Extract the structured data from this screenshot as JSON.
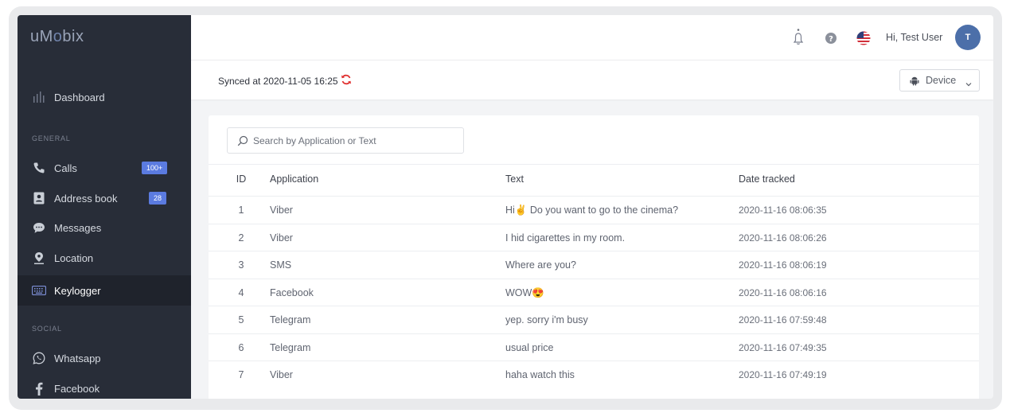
{
  "app": {
    "logo_prefix": "uM",
    "logo_rest": "obix",
    "logo_o": "o"
  },
  "sidebar": {
    "dashboard": {
      "label": "Dashboard",
      "icon": "bar-chart-icon"
    },
    "sections": [
      {
        "label": "GENERAL"
      },
      {
        "label": "SOCIAL"
      }
    ],
    "items": [
      {
        "label": "Calls",
        "icon": "phone-icon",
        "badge": "100+"
      },
      {
        "label": "Address book",
        "icon": "contact-card-icon",
        "badge": "28"
      },
      {
        "label": "Messages",
        "icon": "chat-bubble-icon"
      },
      {
        "label": "Location",
        "icon": "map-pin-icon"
      },
      {
        "label": "Keylogger",
        "icon": "keyboard-icon",
        "active": true
      },
      {
        "label": "Whatsapp",
        "icon": "whatsapp-icon"
      },
      {
        "label": "Facebook",
        "icon": "facebook-icon"
      }
    ]
  },
  "topbar": {
    "greeting": "Hi, Test User",
    "avatar_initial": "T",
    "icons": [
      "bell-icon",
      "help-icon",
      "us-flag-icon"
    ]
  },
  "sync": {
    "text": "Synced at 2020-11-05 16:25",
    "device_label": "Device"
  },
  "search": {
    "placeholder": "Search by Application or Text"
  },
  "table": {
    "columns": [
      "ID",
      "Application",
      "Text",
      "Date tracked"
    ],
    "rows": [
      {
        "id": "1",
        "app": "Viber",
        "text": "Hi✌ Do you want to go to the cinema?",
        "date": "2020-11-16 08:06:35"
      },
      {
        "id": "2",
        "app": "Viber",
        "text": "I hid cigarettes in my room.",
        "date": "2020-11-16 08:06:26"
      },
      {
        "id": "3",
        "app": "SMS",
        "text": "Where are you?",
        "date": "2020-11-16 08:06:19"
      },
      {
        "id": "4",
        "app": "Facebook",
        "text": "WOW😍",
        "date": "2020-11-16 08:06:16"
      },
      {
        "id": "5",
        "app": "Telegram",
        "text": "yep. sorry i'm busy",
        "date": "2020-11-16 07:59:48"
      },
      {
        "id": "6",
        "app": "Telegram",
        "text": "usual price",
        "date": "2020-11-16 07:49:35"
      },
      {
        "id": "7",
        "app": "Viber",
        "text": "haha watch this",
        "date": "2020-11-16 07:49:19"
      }
    ]
  },
  "colors": {
    "sidebar_bg": "#282d38",
    "sidebar_active": "#1f232c",
    "badge": "#5b7be0",
    "avatar": "#4c6fa9",
    "refresh": "#e0302f"
  }
}
